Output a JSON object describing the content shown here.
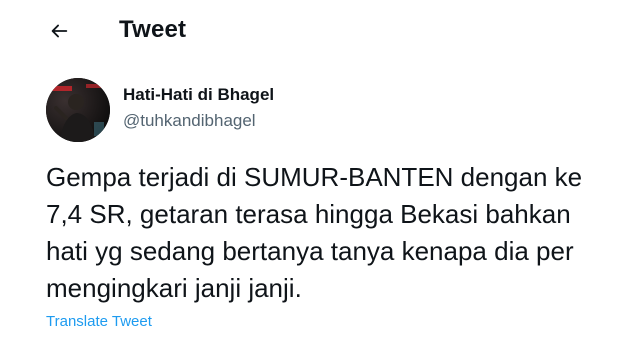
{
  "header": {
    "back_icon": "arrow-left-icon",
    "title": "Tweet"
  },
  "author": {
    "display_name": "Hati-Hati di Bhagel",
    "handle": "@tuhkandibhagel",
    "avatar_icon": "profile-avatar"
  },
  "tweet": {
    "lines": [
      "Gempa terjadi di SUMUR-BANTEN dengan ke",
      "7,4 SR, getaran terasa hingga Bekasi bahkan",
      "hati yg sedang bertanya tanya kenapa dia per",
      "mengingkari janji janji."
    ]
  },
  "translate": {
    "label": "Translate Tweet"
  },
  "colors": {
    "text": "#0f1419",
    "secondary": "#536471",
    "link": "#1d9bf0",
    "background": "#ffffff"
  }
}
